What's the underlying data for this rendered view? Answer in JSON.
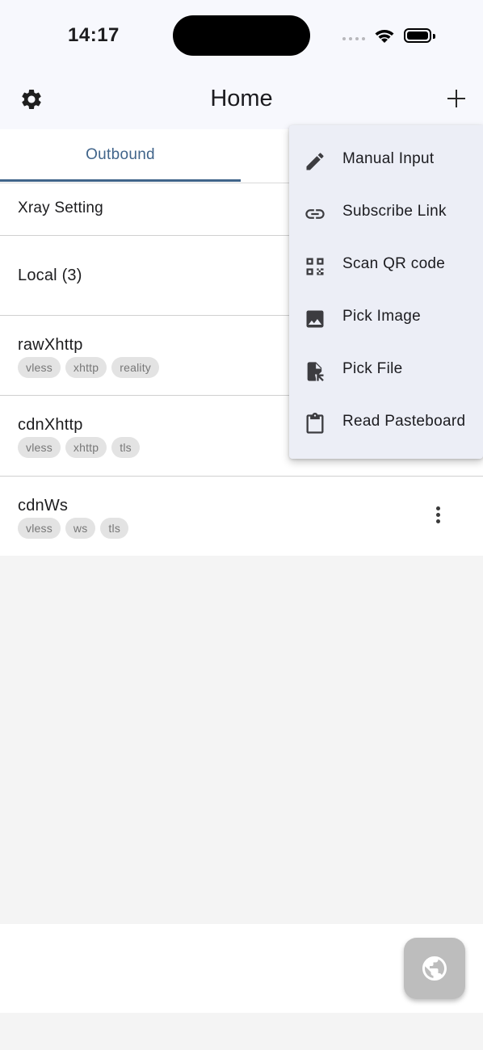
{
  "status_bar": {
    "time": "14:17"
  },
  "header": {
    "title": "Home"
  },
  "tabs": [
    {
      "label": "Outbound"
    }
  ],
  "list": {
    "xray_setting": "Xray Setting",
    "group": "Local (3)",
    "items": [
      {
        "name": "rawXhttp",
        "tags": [
          "vless",
          "xhttp",
          "reality"
        ]
      },
      {
        "name": "cdnXhttp",
        "tags": [
          "vless",
          "xhttp",
          "tls"
        ]
      },
      {
        "name": "cdnWs",
        "tags": [
          "vless",
          "ws",
          "tls"
        ]
      }
    ]
  },
  "add_menu": {
    "items": [
      {
        "label": "Manual Input",
        "icon": "pencil-icon"
      },
      {
        "label": "Subscribe Link",
        "icon": "link-icon"
      },
      {
        "label": "Scan QR code",
        "icon": "qr-code-icon"
      },
      {
        "label": "Pick Image",
        "icon": "image-icon"
      },
      {
        "label": "Pick File",
        "icon": "file-icon"
      },
      {
        "label": "Read Pasteboard",
        "icon": "clipboard-icon"
      }
    ]
  },
  "fab": {
    "icon": "globe-icon"
  },
  "colors": {
    "accent": "#40648a",
    "menu_bg": "#eceef6",
    "fab_bg": "#bdbdbd"
  }
}
